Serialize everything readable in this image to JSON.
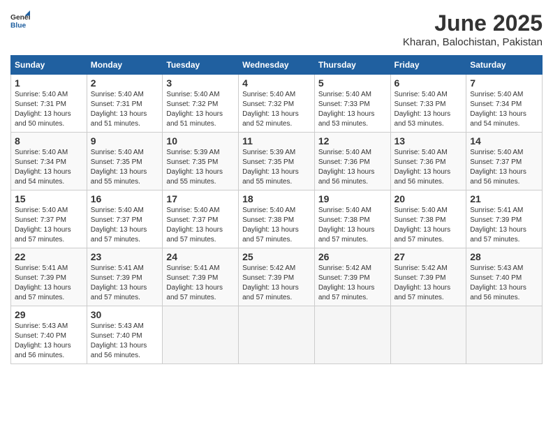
{
  "header": {
    "logo_general": "General",
    "logo_blue": "Blue",
    "month_title": "June 2025",
    "location": "Kharan, Balochistan, Pakistan"
  },
  "calendar": {
    "weekdays": [
      "Sunday",
      "Monday",
      "Tuesday",
      "Wednesday",
      "Thursday",
      "Friday",
      "Saturday"
    ],
    "weeks": [
      [
        {
          "day": "1",
          "sunrise": "5:40 AM",
          "sunset": "7:31 PM",
          "daylight": "13 hours and 50 minutes."
        },
        {
          "day": "2",
          "sunrise": "5:40 AM",
          "sunset": "7:31 PM",
          "daylight": "13 hours and 51 minutes."
        },
        {
          "day": "3",
          "sunrise": "5:40 AM",
          "sunset": "7:32 PM",
          "daylight": "13 hours and 51 minutes."
        },
        {
          "day": "4",
          "sunrise": "5:40 AM",
          "sunset": "7:32 PM",
          "daylight": "13 hours and 52 minutes."
        },
        {
          "day": "5",
          "sunrise": "5:40 AM",
          "sunset": "7:33 PM",
          "daylight": "13 hours and 53 minutes."
        },
        {
          "day": "6",
          "sunrise": "5:40 AM",
          "sunset": "7:33 PM",
          "daylight": "13 hours and 53 minutes."
        },
        {
          "day": "7",
          "sunrise": "5:40 AM",
          "sunset": "7:34 PM",
          "daylight": "13 hours and 54 minutes."
        }
      ],
      [
        {
          "day": "8",
          "sunrise": "5:40 AM",
          "sunset": "7:34 PM",
          "daylight": "13 hours and 54 minutes."
        },
        {
          "day": "9",
          "sunrise": "5:40 AM",
          "sunset": "7:35 PM",
          "daylight": "13 hours and 55 minutes."
        },
        {
          "day": "10",
          "sunrise": "5:39 AM",
          "sunset": "7:35 PM",
          "daylight": "13 hours and 55 minutes."
        },
        {
          "day": "11",
          "sunrise": "5:39 AM",
          "sunset": "7:35 PM",
          "daylight": "13 hours and 55 minutes."
        },
        {
          "day": "12",
          "sunrise": "5:40 AM",
          "sunset": "7:36 PM",
          "daylight": "13 hours and 56 minutes."
        },
        {
          "day": "13",
          "sunrise": "5:40 AM",
          "sunset": "7:36 PM",
          "daylight": "13 hours and 56 minutes."
        },
        {
          "day": "14",
          "sunrise": "5:40 AM",
          "sunset": "7:37 PM",
          "daylight": "13 hours and 56 minutes."
        }
      ],
      [
        {
          "day": "15",
          "sunrise": "5:40 AM",
          "sunset": "7:37 PM",
          "daylight": "13 hours and 57 minutes."
        },
        {
          "day": "16",
          "sunrise": "5:40 AM",
          "sunset": "7:37 PM",
          "daylight": "13 hours and 57 minutes."
        },
        {
          "day": "17",
          "sunrise": "5:40 AM",
          "sunset": "7:37 PM",
          "daylight": "13 hours and 57 minutes."
        },
        {
          "day": "18",
          "sunrise": "5:40 AM",
          "sunset": "7:38 PM",
          "daylight": "13 hours and 57 minutes."
        },
        {
          "day": "19",
          "sunrise": "5:40 AM",
          "sunset": "7:38 PM",
          "daylight": "13 hours and 57 minutes."
        },
        {
          "day": "20",
          "sunrise": "5:40 AM",
          "sunset": "7:38 PM",
          "daylight": "13 hours and 57 minutes."
        },
        {
          "day": "21",
          "sunrise": "5:41 AM",
          "sunset": "7:39 PM",
          "daylight": "13 hours and 57 minutes."
        }
      ],
      [
        {
          "day": "22",
          "sunrise": "5:41 AM",
          "sunset": "7:39 PM",
          "daylight": "13 hours and 57 minutes."
        },
        {
          "day": "23",
          "sunrise": "5:41 AM",
          "sunset": "7:39 PM",
          "daylight": "13 hours and 57 minutes."
        },
        {
          "day": "24",
          "sunrise": "5:41 AM",
          "sunset": "7:39 PM",
          "daylight": "13 hours and 57 minutes."
        },
        {
          "day": "25",
          "sunrise": "5:42 AM",
          "sunset": "7:39 PM",
          "daylight": "13 hours and 57 minutes."
        },
        {
          "day": "26",
          "sunrise": "5:42 AM",
          "sunset": "7:39 PM",
          "daylight": "13 hours and 57 minutes."
        },
        {
          "day": "27",
          "sunrise": "5:42 AM",
          "sunset": "7:39 PM",
          "daylight": "13 hours and 57 minutes."
        },
        {
          "day": "28",
          "sunrise": "5:43 AM",
          "sunset": "7:40 PM",
          "daylight": "13 hours and 56 minutes."
        }
      ],
      [
        {
          "day": "29",
          "sunrise": "5:43 AM",
          "sunset": "7:40 PM",
          "daylight": "13 hours and 56 minutes."
        },
        {
          "day": "30",
          "sunrise": "5:43 AM",
          "sunset": "7:40 PM",
          "daylight": "13 hours and 56 minutes."
        },
        null,
        null,
        null,
        null,
        null
      ]
    ]
  }
}
